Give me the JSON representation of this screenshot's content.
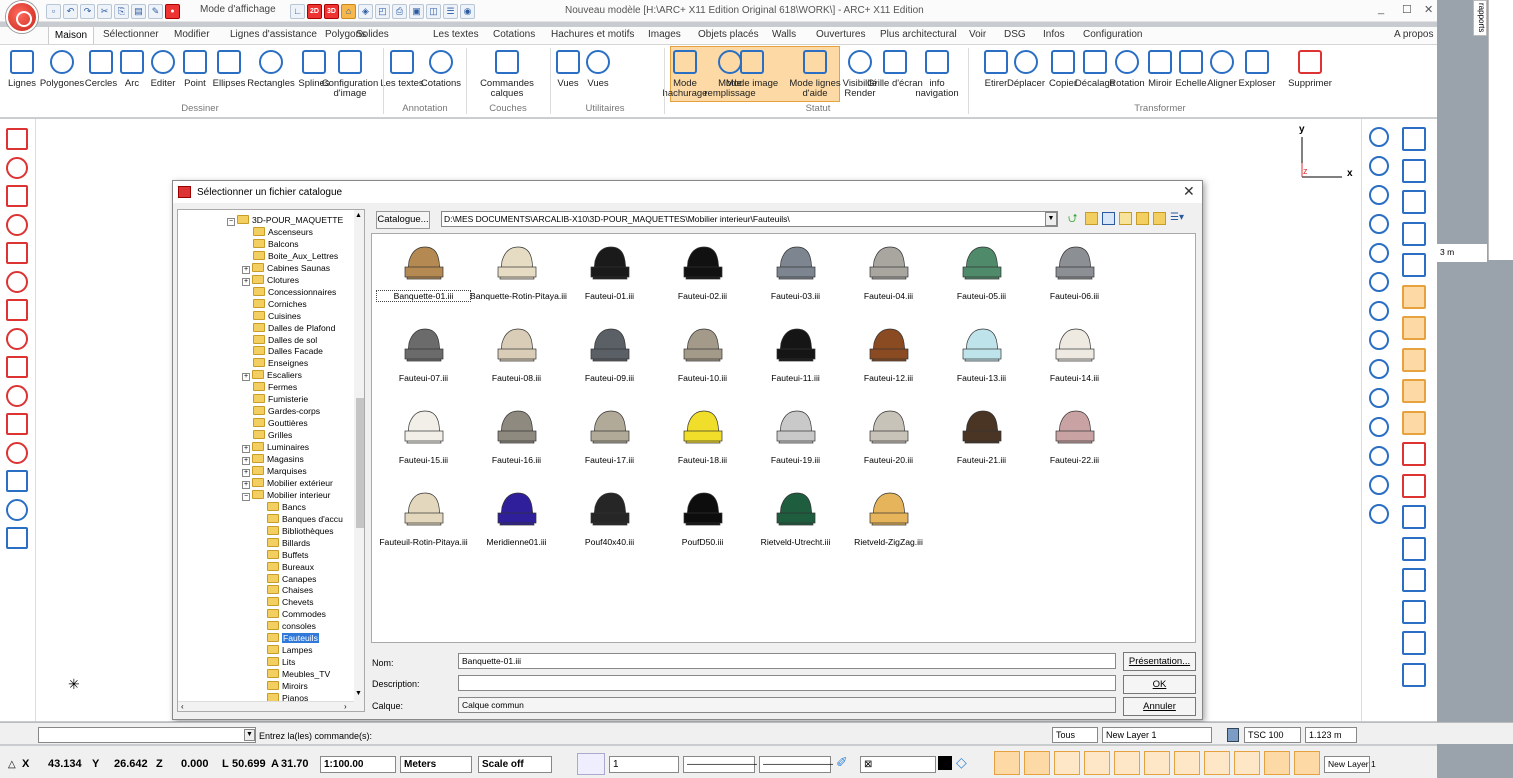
{
  "title_bar": {
    "mode_display": "Mode d'affichage",
    "document_title": "Nouveau modèle [H:\\ARC+ X11 Edition Original 618\\WORK\\] - ARC+ X11 Edition",
    "controls": [
      "_",
      "☐",
      "✕"
    ]
  },
  "ribbon_tabs": [
    "Maison",
    "Sélectionner",
    "Modifier",
    "Lignes d'assistance",
    "Polygons",
    "Solides",
    "Les textes",
    "Cotations",
    "Hachures et motifs",
    "Images",
    "Objets placés",
    "Walls",
    "Ouvertures",
    "Plus architectural",
    "Voir",
    "DSG",
    "Infos",
    "Configuration"
  ],
  "ribbon_right": "A propos",
  "ribbon_groups": {
    "dessiner": {
      "label": "Dessiner",
      "buttons": [
        "Lignes",
        "Polygones",
        "Cercles",
        "Arc",
        "Editer",
        "Point",
        "Ellipses",
        "Rectangles",
        "Splines",
        "Configuration d'image"
      ]
    },
    "annotation": {
      "label": "Annotation",
      "buttons": [
        "Les textes",
        "Cotations"
      ]
    },
    "couches": {
      "label": "Couches",
      "buttons": [
        "Commandes calques"
      ]
    },
    "utilitaires": {
      "label": "Utilitaires",
      "buttons": [
        "Vues",
        "Vues"
      ]
    },
    "statut": {
      "label": "Statut",
      "buttons": [
        "Mode hachurage",
        "Mode remplissage",
        "Mode image",
        "Mode lignes d'aide",
        "Visibilité Render",
        "Grille d'écran",
        "info navigation"
      ]
    },
    "transformer": {
      "label": "Transformer",
      "buttons": [
        "Etirer",
        "Déplacer",
        "Copier",
        "Décalage",
        "Rotation",
        "Miroir",
        "Echelle",
        "Aligner",
        "Exploser",
        "Supprimer"
      ]
    }
  },
  "axis_labels": {
    "y": "y",
    "x": "x",
    "z": "z"
  },
  "dialog": {
    "title": "Sélectionner un fichier catalogue",
    "catalogue_button": "Catalogue...",
    "path": "D:\\MES DOCUMENTS\\ARCALIB-X10\\3D-POUR_MAQUETTES\\Mobilier interieur\\Fauteuils\\",
    "tree": [
      "3D-POUR_MAQUETTE",
      "Ascenseurs",
      "Balcons",
      "Boite_Aux_Lettres",
      "Cabines Saunas",
      "Clotures",
      "Concessionnaires",
      "Corniches",
      "Cuisines",
      "Dalles de Plafond",
      "Dalles de sol",
      "Dalles Facade",
      "Enseignes",
      "Escaliers",
      "Fermes",
      "Fumisterie",
      "Gardes-corps",
      "Gouttières",
      "Grilles",
      "Luminaires",
      "Magasins",
      "Marquises",
      "Mobilier extérieur",
      "Mobilier interieur",
      "Bancs",
      "Banques d'accu",
      "Bibliothèques",
      "Billards",
      "Buffets",
      "Bureaux",
      "Canapes",
      "Chaises",
      "Chevets",
      "Commodes",
      "consoles",
      "Fauteuils",
      "Lampes",
      "Lits",
      "Meubles_TV",
      "Miroirs",
      "Pianos"
    ],
    "files": [
      {
        "name": "Banquette-01.iii",
        "color": "#b58a52"
      },
      {
        "name": "Banquette-Rotin-Pitaya.iii",
        "color": "#e6dcc4"
      },
      {
        "name": "Fauteui-01.iii",
        "color": "#1a1a1a"
      },
      {
        "name": "Fauteui-02.iii",
        "color": "#111111"
      },
      {
        "name": "Fauteui-03.iii",
        "color": "#7d8690"
      },
      {
        "name": "Fauteui-04.iii",
        "color": "#a9a6a0"
      },
      {
        "name": "Fauteui-05.iii",
        "color": "#4f8a6a"
      },
      {
        "name": "Fauteui-06.iii",
        "color": "#8c8f93"
      },
      {
        "name": "Fauteui-07.iii",
        "color": "#6b6b6b"
      },
      {
        "name": "Fauteui-08.iii",
        "color": "#d9cdb7"
      },
      {
        "name": "Fauteui-09.iii",
        "color": "#5b5f66"
      },
      {
        "name": "Fauteui-10.iii",
        "color": "#a39a8a"
      },
      {
        "name": "Fauteui-11.iii",
        "color": "#151515"
      },
      {
        "name": "Fauteui-12.iii",
        "color": "#8a4a22"
      },
      {
        "name": "Fauteui-13.iii",
        "color": "#bfe3ea"
      },
      {
        "name": "Fauteui-14.iii",
        "color": "#eeeae2"
      },
      {
        "name": "Fauteui-15.iii",
        "color": "#f2efe8"
      },
      {
        "name": "Fauteui-16.iii",
        "color": "#8f8a80"
      },
      {
        "name": "Fauteui-17.iii",
        "color": "#b2aa98"
      },
      {
        "name": "Fauteui-18.iii",
        "color": "#f0de2a"
      },
      {
        "name": "Fauteui-19.iii",
        "color": "#c9c9c9"
      },
      {
        "name": "Fauteui-20.iii",
        "color": "#c8c3b8"
      },
      {
        "name": "Fauteui-21.iii",
        "color": "#4a3524"
      },
      {
        "name": "Fauteui-22.iii",
        "color": "#c9a3a3"
      },
      {
        "name": "Fauteuil-Rotin-Pitaya.iii",
        "color": "#e3d7bd"
      },
      {
        "name": "Meridienne01.iii",
        "color": "#2f1f9a"
      },
      {
        "name": "Pouf40x40.iii",
        "color": "#262626"
      },
      {
        "name": "PoufD50.iii",
        "color": "#0d0d0d"
      },
      {
        "name": "Rietveld-Utrecht.iii",
        "color": "#1e5d3e"
      },
      {
        "name": "Rietveld-ZigZag.iii",
        "color": "#e6b45a"
      }
    ],
    "nom_label": "Nom:",
    "nom_value": "Banquette-01.iii",
    "description_label": "Description:",
    "description_value": "",
    "calque_label": "Calque:",
    "calque_value": "Calque commun",
    "presentation_button": "Présentation...",
    "ok_button": "OK",
    "annuler_button": "Annuler"
  },
  "command": {
    "prompt": "Entrez la(les) commande(s):",
    "filter": "Tous",
    "layer": "New Layer 1",
    "tsc": "TSC 100",
    "measure": "1.123 m"
  },
  "status": {
    "x_label": "X",
    "x": "43.134",
    "y_label": "Y",
    "y": "26.642",
    "z_label": "Z",
    "z": "0.000",
    "l_label": "L",
    "l": "50.699",
    "a_label": "A",
    "a": "31.70",
    "scale": "1:100.00",
    "units": "Meters",
    "scale_mode": "Scale off",
    "line_weight": "1",
    "layer_right": "New Layer 1"
  },
  "right_panel": {
    "label": "rapports",
    "measure": "3 m"
  }
}
